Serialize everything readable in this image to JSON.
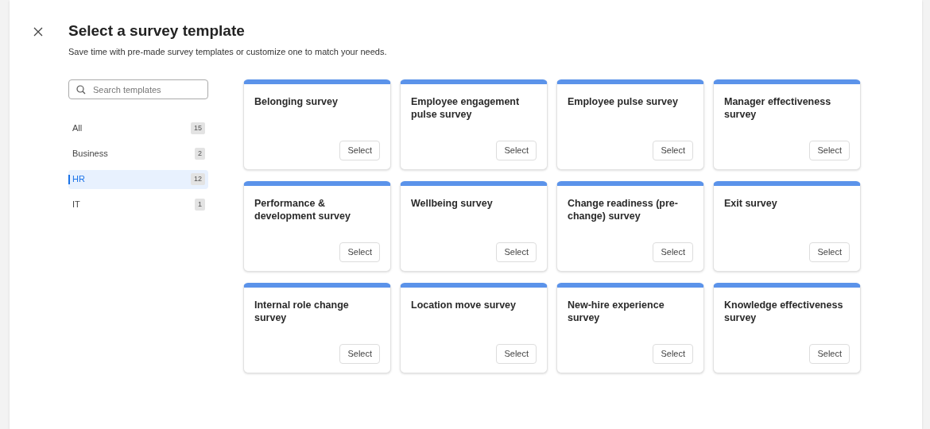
{
  "dialog": {
    "title": "Select a survey template",
    "subtitle": "Save time with pre-made survey templates or customize one to match your needs."
  },
  "search": {
    "placeholder": "Search templates"
  },
  "categories": [
    {
      "label": "All",
      "count": "15",
      "selected": false
    },
    {
      "label": "Business",
      "count": "2",
      "selected": false
    },
    {
      "label": "HR",
      "count": "12",
      "selected": true
    },
    {
      "label": "IT",
      "count": "1",
      "selected": false
    }
  ],
  "templates": [
    {
      "title": "Belonging survey",
      "button": "Select"
    },
    {
      "title": "Employee engagement pulse survey",
      "button": "Select"
    },
    {
      "title": "Employee pulse survey",
      "button": "Select"
    },
    {
      "title": "Manager effectiveness survey",
      "button": "Select"
    },
    {
      "title": "Performance & development survey",
      "button": "Select"
    },
    {
      "title": "Wellbeing survey",
      "button": "Select"
    },
    {
      "title": "Change readiness (pre-change) survey",
      "button": "Select"
    },
    {
      "title": "Exit survey",
      "button": "Select"
    },
    {
      "title": "Internal role change survey",
      "button": "Select"
    },
    {
      "title": "Location move survey",
      "button": "Select"
    },
    {
      "title": "New-hire experience survey",
      "button": "Select"
    },
    {
      "title": "Knowledge effectiveness survey",
      "button": "Select"
    }
  ]
}
